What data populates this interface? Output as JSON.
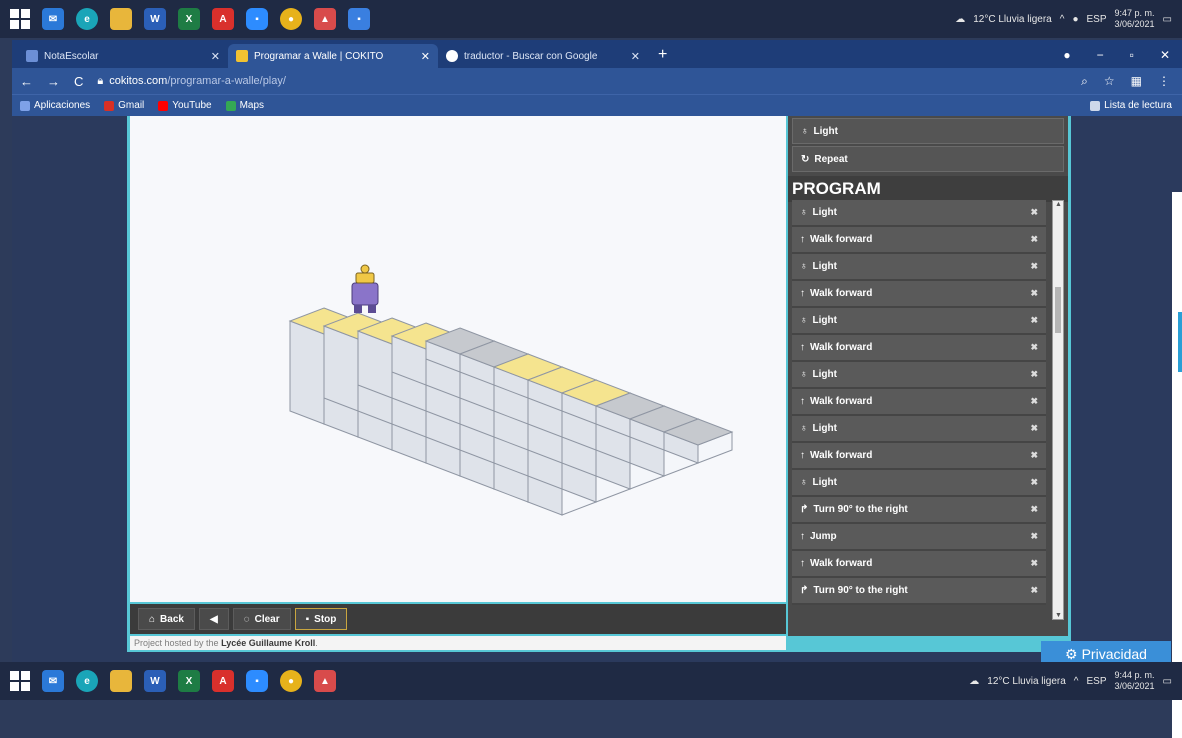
{
  "taskbar": {
    "weather": "12°C Lluvia ligera",
    "lang": "ESP",
    "top_time": "9:47 p. m.",
    "top_date": "3/06/2021",
    "bottom_weather": "12°C Lluvia ligera",
    "bottom_time": "9:44 p. m.",
    "bottom_date": "3/06/2021",
    "icons": [
      "windows-start",
      "mail",
      "edge",
      "file-explorer",
      "word",
      "excel",
      "acrobat",
      "zoom",
      "chrome",
      "app"
    ]
  },
  "browser": {
    "tabs": [
      {
        "label": "NotaEscolar",
        "active": false
      },
      {
        "label": "Programar a Walle | COKITO",
        "active": true
      },
      {
        "label": "traductor - Buscar con Google",
        "active": false
      }
    ],
    "url_host": "cokitos.com",
    "url_path": "/programar-a-walle/play/",
    "bookmarks": [
      "Aplicaciones",
      "Gmail",
      "YouTube",
      "Maps"
    ],
    "reading_list": "Lista de lectura"
  },
  "game": {
    "palette_commands": [
      "Light",
      "Repeat"
    ],
    "program_title": "PROGRAM",
    "program": [
      {
        "icon": "bulb",
        "label": "Light"
      },
      {
        "icon": "arrow-up",
        "label": "Walk forward"
      },
      {
        "icon": "bulb",
        "label": "Light"
      },
      {
        "icon": "arrow-up",
        "label": "Walk forward"
      },
      {
        "icon": "bulb",
        "label": "Light"
      },
      {
        "icon": "arrow-up",
        "label": "Walk forward"
      },
      {
        "icon": "bulb",
        "label": "Light"
      },
      {
        "icon": "arrow-up",
        "label": "Walk forward"
      },
      {
        "icon": "bulb",
        "label": "Light"
      },
      {
        "icon": "arrow-up",
        "label": "Walk forward"
      },
      {
        "icon": "bulb",
        "label": "Light"
      },
      {
        "icon": "turn-right",
        "label": "Turn 90° to the right"
      },
      {
        "icon": "arrow-up",
        "label": "Jump"
      },
      {
        "icon": "arrow-up",
        "label": "Walk forward"
      },
      {
        "icon": "turn-right",
        "label": "Turn 90° to the right"
      }
    ],
    "controls": {
      "back": "Back",
      "clear": "Clear",
      "stop": "Stop"
    },
    "footer_prefix": "Project hosted by the",
    "footer_org": "Lycée Guillaume Kroll",
    "colors": {
      "lit_tile": "#f5e48f",
      "target_tile": "#3b7ee0",
      "block": "#e9ecf3",
      "gray_top": "#c6c9ce"
    }
  },
  "privacy_label": "Privacidad"
}
